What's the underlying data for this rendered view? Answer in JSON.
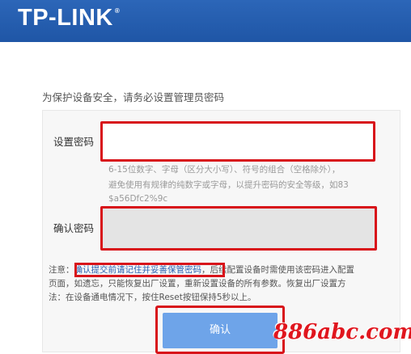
{
  "header": {
    "logo": "TP-LINK",
    "reg_mark": "®"
  },
  "intro": "为保护设备安全，请务必设置管理员密码",
  "form": {
    "password_label": "设置密码",
    "password_value": "",
    "hint_lines": [
      "6-15位数字、字母（区分大小写）、符号的组合（空格除外），",
      "避免使用有规律的纯数字或字母，以提升密码的安全等级，如83",
      "$a56Dfc2%9c"
    ],
    "confirm_label": "确认密码",
    "confirm_value": ""
  },
  "note": {
    "prefix": "注意：",
    "highlight": "确认提交前请记住并妥善保管密码",
    "line1_rest": "，后续配置设备时需使用该密码进入配置",
    "line2": "页面，如遗忘，只能恢复出厂设置，重新设置设备的所有参数。恢复出厂设置方",
    "line3": "法：在设备通电情况下，按住Reset按钮保持5秒以上。"
  },
  "submit_label": "确认",
  "watermark": "886abc.com",
  "colors": {
    "header": "#2160b0",
    "highlight_red": "#d8131a",
    "button": "#6ea4e9"
  }
}
